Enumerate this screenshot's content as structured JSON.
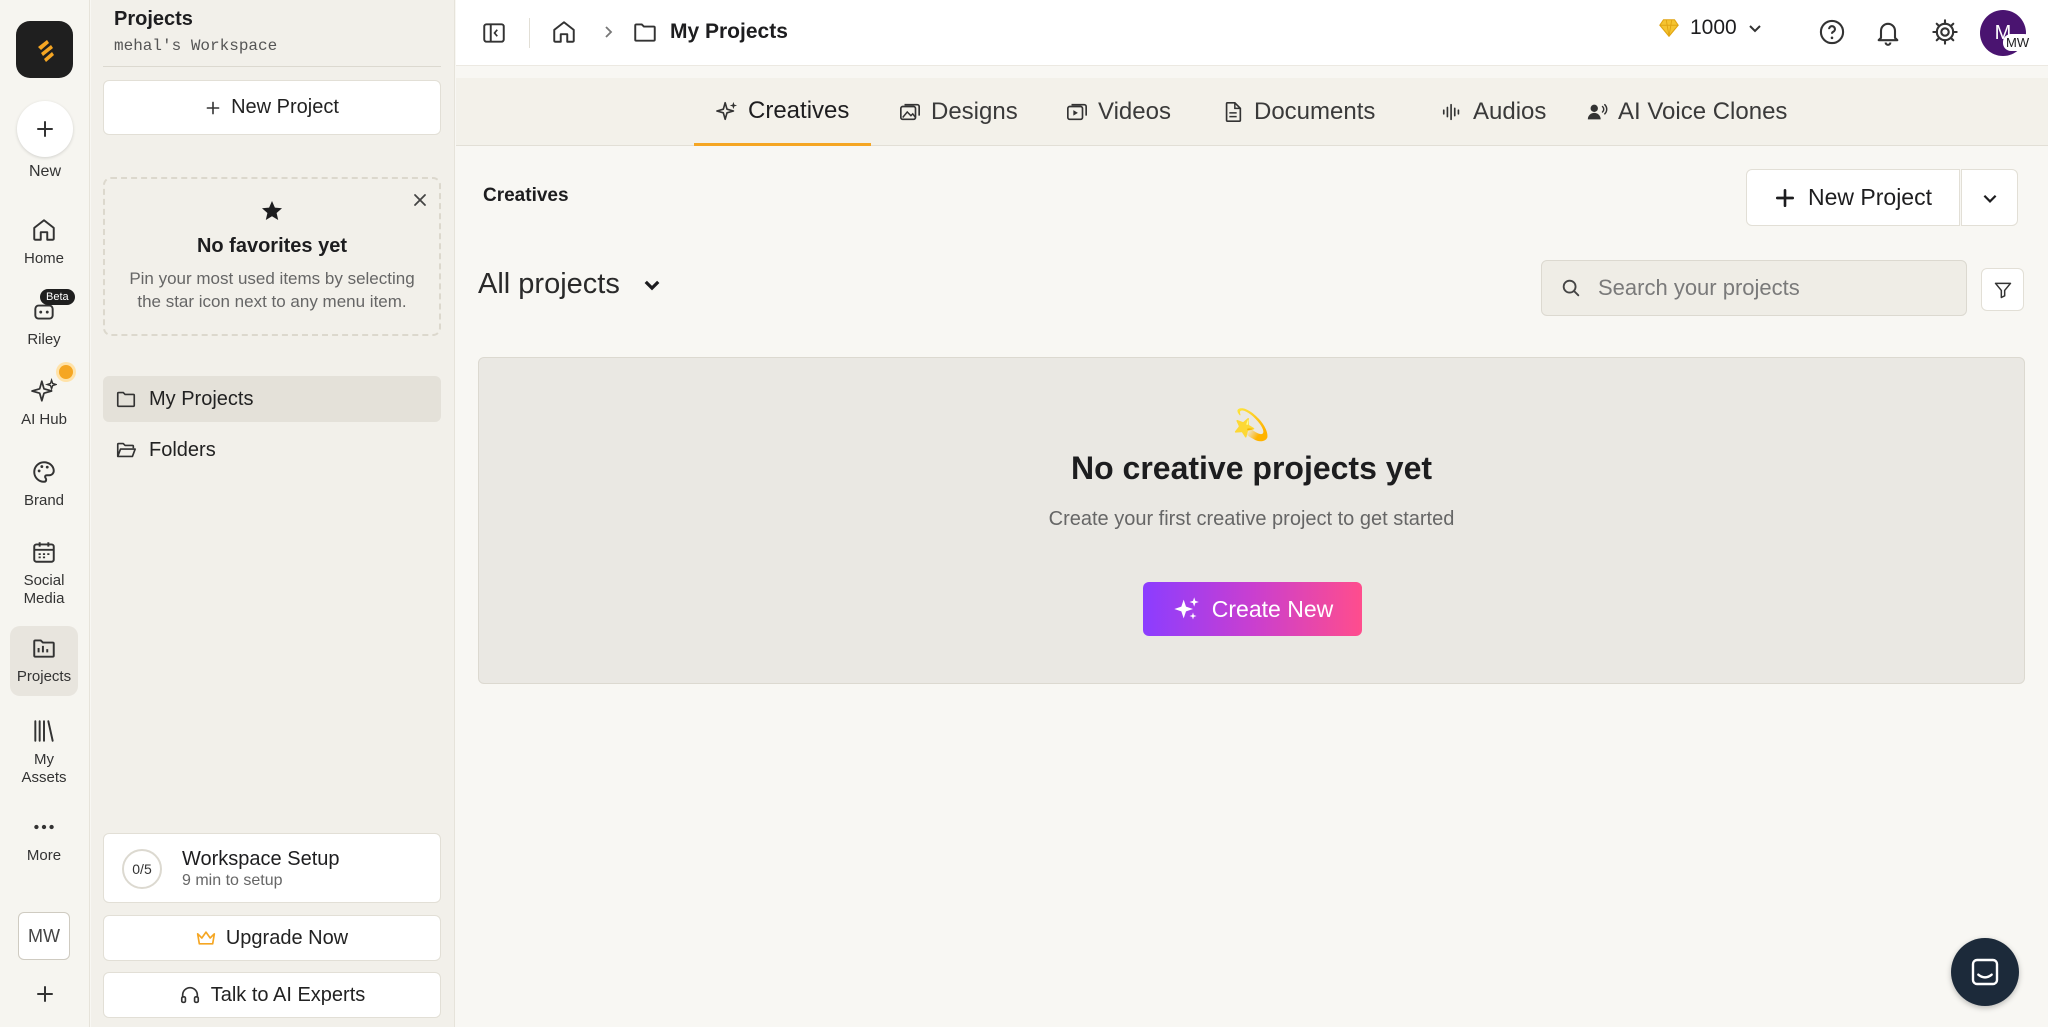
{
  "rail": {
    "new_label": "New",
    "beta_badge": "Beta",
    "items": [
      {
        "label": "Home"
      },
      {
        "label": "Riley"
      },
      {
        "label": "AI Hub"
      },
      {
        "label": "Brand"
      },
      {
        "label": "Social Media"
      },
      {
        "label": "Projects"
      },
      {
        "label": "My Assets"
      },
      {
        "label": "More"
      }
    ],
    "workspace_initials": "MW"
  },
  "sidebar": {
    "title": "Projects",
    "workspace_name": "mehal's Workspace",
    "new_project_label": "New Project",
    "favorites": {
      "title": "No favorites yet",
      "text": "Pin your most used items by selecting the star icon next to any menu item."
    },
    "nav": [
      {
        "label": "My Projects"
      },
      {
        "label": "Folders"
      }
    ],
    "setup": {
      "progress": "0/5",
      "title": "Workspace Setup",
      "subtitle": "9 min to setup"
    },
    "upgrade_label": "Upgrade Now",
    "experts_label": "Talk to AI Experts"
  },
  "header": {
    "breadcrumb": "My Projects",
    "credits": "1000",
    "avatar_initial": "M",
    "avatar_mini": "MW"
  },
  "tabs": [
    {
      "label": "Creatives"
    },
    {
      "label": "Designs"
    },
    {
      "label": "Videos"
    },
    {
      "label": "Documents"
    },
    {
      "label": "Audios"
    },
    {
      "label": "AI Voice Clones"
    }
  ],
  "main": {
    "section_title": "Creatives",
    "new_project_label": "New Project",
    "filter_label": "All projects",
    "search_placeholder": "Search your projects",
    "empty": {
      "emoji": "💫",
      "title": "No creative projects yet",
      "subtitle": "Create your first creative project to get started",
      "cta": "Create New"
    }
  },
  "colors": {
    "accent": "#f5a623",
    "avatar_bg": "#4a1470",
    "cta_gradient_start": "#8b3dff",
    "cta_gradient_end": "#ff4d8d"
  }
}
